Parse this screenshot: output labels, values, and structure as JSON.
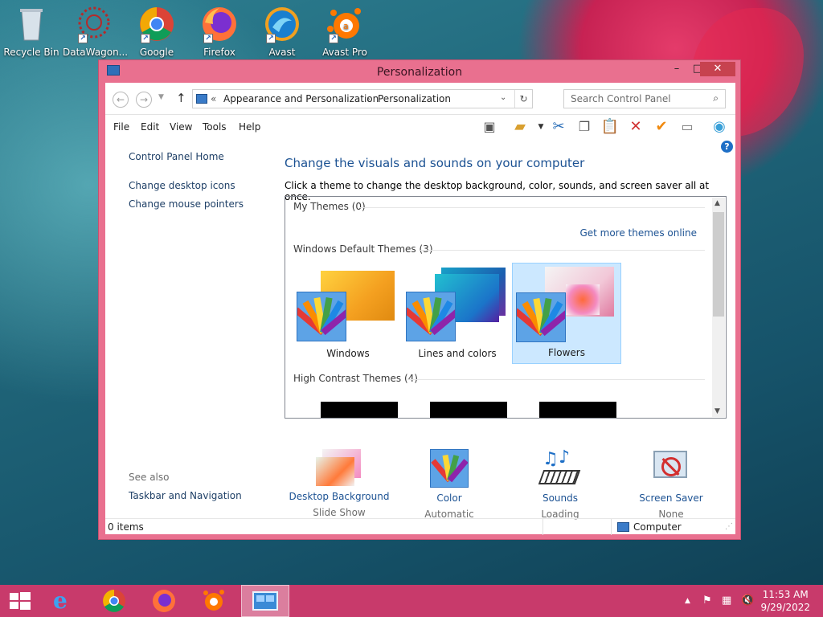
{
  "desktop": {
    "icons": [
      {
        "label": "Recycle Bin",
        "icon": "recycle-bin-icon"
      },
      {
        "label": "DataWagon...",
        "icon": "datawagon-icon"
      },
      {
        "label": "Google",
        "icon": "chrome-icon"
      },
      {
        "label": "Firefox",
        "icon": "firefox-icon"
      },
      {
        "label": "Avast",
        "icon": "avast-icon"
      },
      {
        "label": "Avast Pro",
        "icon": "avast-pro-icon"
      }
    ]
  },
  "window": {
    "title": "Personalization",
    "minimize": "–",
    "maximize": "□",
    "close": "✕"
  },
  "address": {
    "chevrons": "«",
    "crumb1": "Appearance and Personalization",
    "sep": "›",
    "crumb2": "Personalization",
    "search_placeholder": "Search Control Panel"
  },
  "menu": [
    "File",
    "Edit",
    "View",
    "Tools",
    "Help"
  ],
  "left_nav": {
    "home": "Control Panel Home",
    "links": [
      "Change desktop icons",
      "Change mouse pointers"
    ],
    "see_also": "See also",
    "taskbar_nav": "Taskbar and Navigation"
  },
  "main": {
    "heading": "Change the visuals and sounds on your computer",
    "subtitle": "Click a theme to change the desktop background, color, sounds, and screen saver all at once.",
    "my_themes": "My Themes (0)",
    "get_more": "Get more themes online",
    "default_themes": "Windows Default Themes (3)",
    "themes": [
      "Windows",
      "Lines and colors",
      "Flowers"
    ],
    "selected_theme": "Flowers",
    "high_contrast": "High Contrast Themes (4)"
  },
  "bottom_settings": [
    {
      "label": "Desktop Background",
      "value": "Slide Show"
    },
    {
      "label": "Color",
      "value": "Automatic"
    },
    {
      "label": "Sounds",
      "value": "Loading"
    },
    {
      "label": "Screen Saver",
      "value": "None"
    }
  ],
  "status": {
    "items": "0 items",
    "location": "Computer"
  },
  "clock": {
    "time": "11:53 AM",
    "date": "9/29/2022"
  },
  "colors": {
    "accent": "#e9708f",
    "link": "#1c5293",
    "taskbar": "#c83a6b",
    "selection": "#cce8ff"
  }
}
